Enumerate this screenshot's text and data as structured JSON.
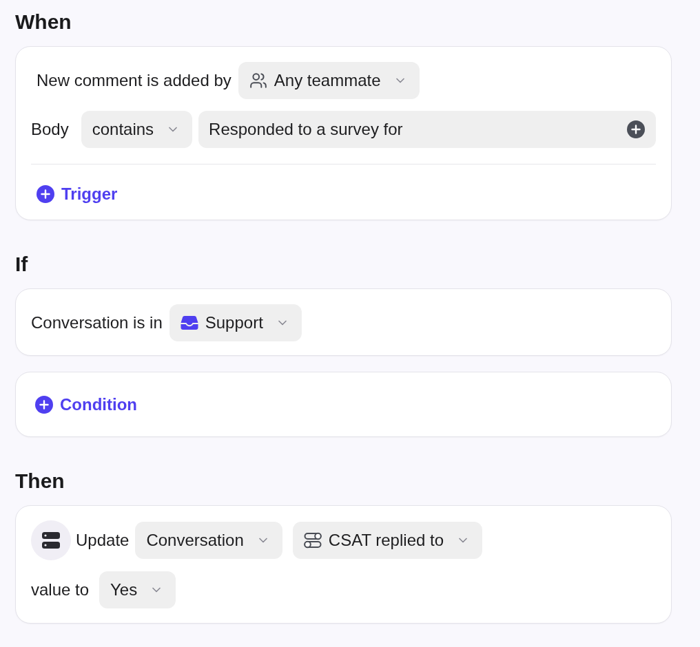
{
  "when": {
    "heading": "When",
    "trigger": {
      "label": "New comment is added by",
      "selector": "Any teammate"
    },
    "filter": {
      "label": "Body",
      "operator": "contains",
      "value": "Responded to a survey for"
    },
    "add_button": "Trigger"
  },
  "if": {
    "heading": "If",
    "condition": {
      "label": "Conversation is in",
      "selector": "Support"
    },
    "add_button": "Condition"
  },
  "then": {
    "heading": "Then",
    "action": {
      "verb": "Update",
      "object": "Conversation",
      "field": "CSAT replied to",
      "value_label": "value to",
      "value": "Yes"
    }
  }
}
